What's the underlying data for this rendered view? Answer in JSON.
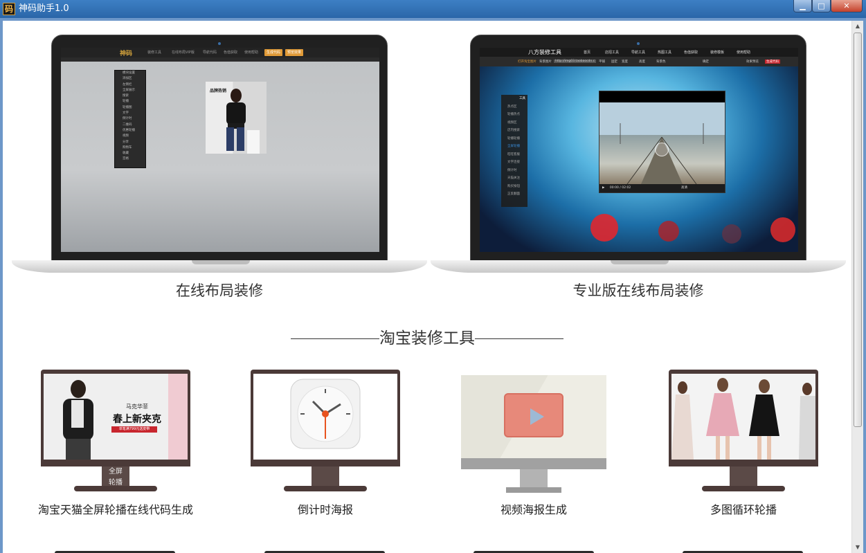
{
  "window": {
    "title": "神码助手1.0",
    "icon_glyph": "码",
    "controls": {
      "minimize": "▁",
      "maximize": "□",
      "close": "✕"
    }
  },
  "laptops": [
    {
      "caption": "在线布局装修",
      "screen": {
        "logo": "神码",
        "menu": [
          "装修工具",
          "在线布局VIP版",
          "导航代码",
          "色值获取",
          "使用帮助"
        ],
        "buttons": [
          "生成代码",
          "预览效果"
        ],
        "panel_items": [
          "模块设置",
          "添加区",
          "左侧栏",
          "全屏展示",
          "搜索",
          "轮播",
          "轮播图",
          "文字",
          "倒计时",
          "二维码",
          "优惠轮播",
          "视频",
          "分享",
          "购物车",
          "收藏",
          "宫格"
        ],
        "poster_title": "品牌热销"
      }
    },
    {
      "caption": "专业版在线布局装修",
      "screen": {
        "title": "八方装修工具",
        "menu": [
          "首页",
          "店招工具",
          "导航工具",
          "热图工具",
          "色值获取",
          "装修模板",
          "使用帮助"
        ],
        "toolbar": [
          "打开淘宝图片",
          "背景图片",
          "http://img03.taobaocdn.c",
          "平铺",
          "固定",
          "宽度",
          "高度",
          "背景色",
          "确定",
          "效果预览",
          "生成代码"
        ],
        "panel_title": "工具",
        "panel_items": [
          "热点区",
          "轮播热点",
          "视频区",
          "店内搜索",
          "轮播轮播",
          "全屏轮播",
          "旺旺客服",
          "文字连接",
          "倒计时",
          "天猫关注",
          "购买按钮",
          "正反翻面"
        ],
        "video_time": "00:00 / 02:02",
        "video_quality": "高清"
      }
    }
  ],
  "section_title": "淘宝装修工具",
  "tools": [
    {
      "caption": "淘宝天猫全屏轮播在线代码生成",
      "screen_line1": "马克华菲",
      "screen_line2": "春上新夹克",
      "screen_tag": "单笔满799元送皮带",
      "stand_label_1": "全屏",
      "stand_label_2": "轮播"
    },
    {
      "caption": "倒计时海报"
    },
    {
      "caption": "视频海报生成"
    },
    {
      "caption": "多图循环轮播"
    }
  ],
  "colors": {
    "titlebar": "#2f6fb2",
    "accent_orange": "#e09a37",
    "monitor_bezel": "#4b3a38",
    "clock_hand": "#e8531f"
  }
}
